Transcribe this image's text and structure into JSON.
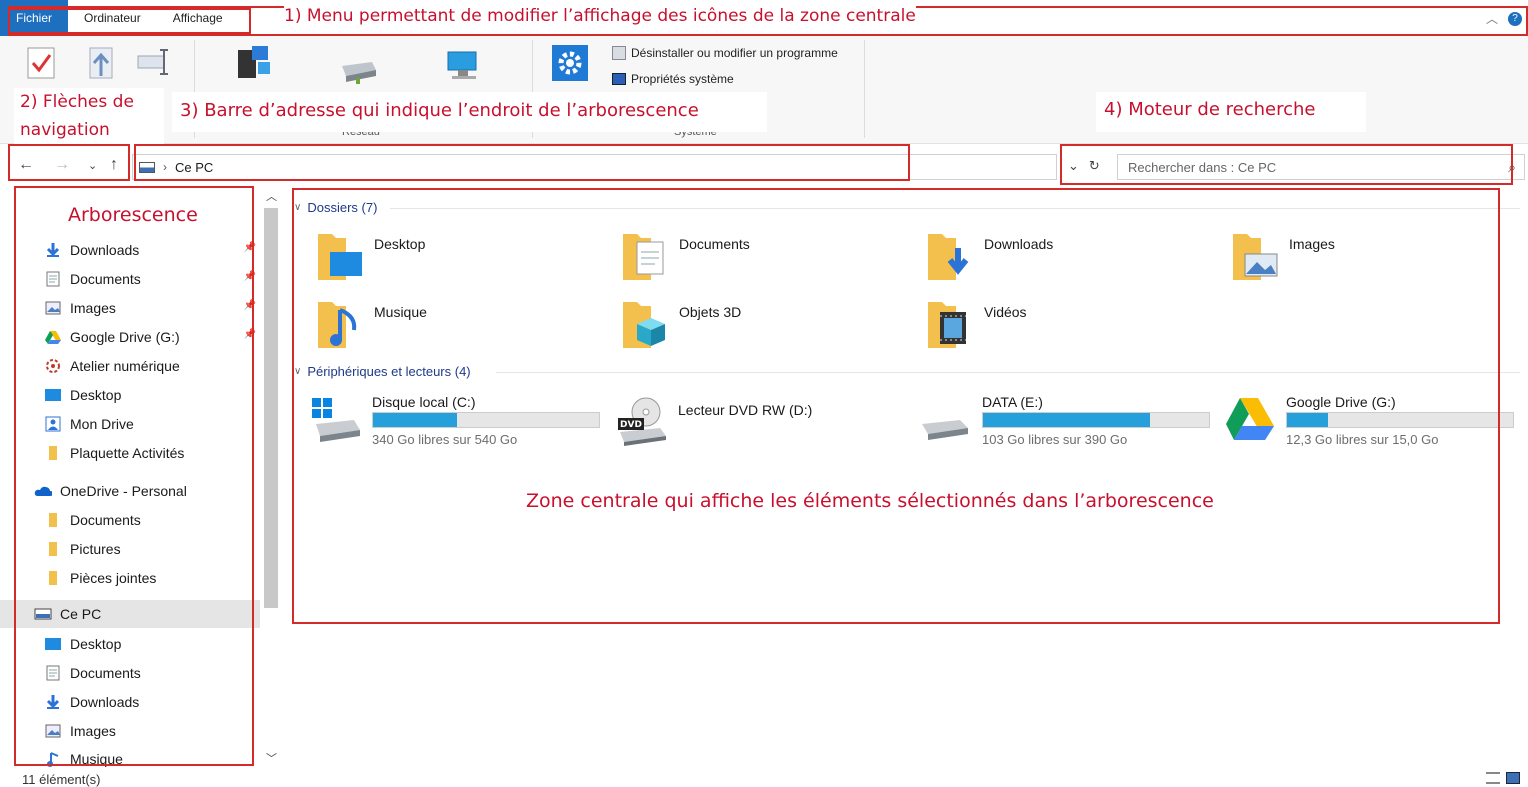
{
  "ribbon": {
    "tabs": [
      "Fichier",
      "Ordinateur",
      "Affichage"
    ],
    "groups": {
      "reseau": "Réseau",
      "systeme": "Système"
    },
    "commands": {
      "uninstall": "Désinstaller ou modifier un programme",
      "system_props": "Propriétés système"
    }
  },
  "annotations": {
    "menu": "1) Menu permettant de modifier l’affichage des icônes de la zone centrale",
    "nav": "2) Flèches de navigation",
    "address": "3) Barre d’adresse qui indique l’endroit de l’arborescence",
    "search": "4) Moteur de recherche",
    "tree": "Arborescence",
    "center": "Zone centrale qui affiche les éléments sélectionnés dans l’arborescence"
  },
  "address_bar": {
    "path": "Ce PC"
  },
  "search": {
    "placeholder": "Rechercher dans : Ce PC"
  },
  "tree": {
    "quick": [
      {
        "label": "Downloads",
        "icon": "download-icon",
        "pinned": true
      },
      {
        "label": "Documents",
        "icon": "document-icon",
        "pinned": true
      },
      {
        "label": "Images",
        "icon": "image-icon",
        "pinned": true
      },
      {
        "label": "Google Drive (G:)",
        "icon": "google-drive-icon",
        "pinned": true
      },
      {
        "label": "Atelier numérique",
        "icon": "settings-icon",
        "pinned": false
      },
      {
        "label": "Desktop",
        "icon": "desktop-icon",
        "pinned": false
      },
      {
        "label": "Mon Drive",
        "icon": "drive-shortcut-icon",
        "pinned": false
      },
      {
        "label": "Plaquette Activités",
        "icon": "folder-icon",
        "pinned": false
      }
    ],
    "onedrive": {
      "label": "OneDrive - Personal",
      "children": [
        "Documents",
        "Pictures",
        "Pièces jointes"
      ]
    },
    "thispc": {
      "label": "Ce PC",
      "children": [
        {
          "label": "Desktop",
          "icon": "desktop-icon"
        },
        {
          "label": "Documents",
          "icon": "document-icon"
        },
        {
          "label": "Downloads",
          "icon": "download-icon"
        },
        {
          "label": "Images",
          "icon": "image-icon"
        },
        {
          "label": "Musique",
          "icon": "music-icon"
        }
      ]
    }
  },
  "main": {
    "folders_header": "Dossiers (7)",
    "folders": [
      "Desktop",
      "Documents",
      "Downloads",
      "Images",
      "Musique",
      "Objets 3D",
      "Vidéos"
    ],
    "drives_header": "Périphériques et lecteurs (4)",
    "drives": [
      {
        "name": "Disque local (C:)",
        "free": "340 Go libres sur 540 Go",
        "used_fraction": 0.37
      },
      {
        "name": "Lecteur DVD RW (D:)",
        "free": "",
        "used_fraction": null
      },
      {
        "name": "DATA (E:)",
        "free": "103 Go libres sur 390 Go",
        "used_fraction": 0.74
      },
      {
        "name": "Google Drive (G:)",
        "free": "12,3 Go libres sur 15,0 Go",
        "used_fraction": 0.18
      }
    ]
  },
  "status": {
    "count": "11 élément(s)"
  },
  "colors": {
    "accent": "#1f6fbf",
    "annotation": "#c8102e",
    "bar_fill": "#26a0da"
  }
}
